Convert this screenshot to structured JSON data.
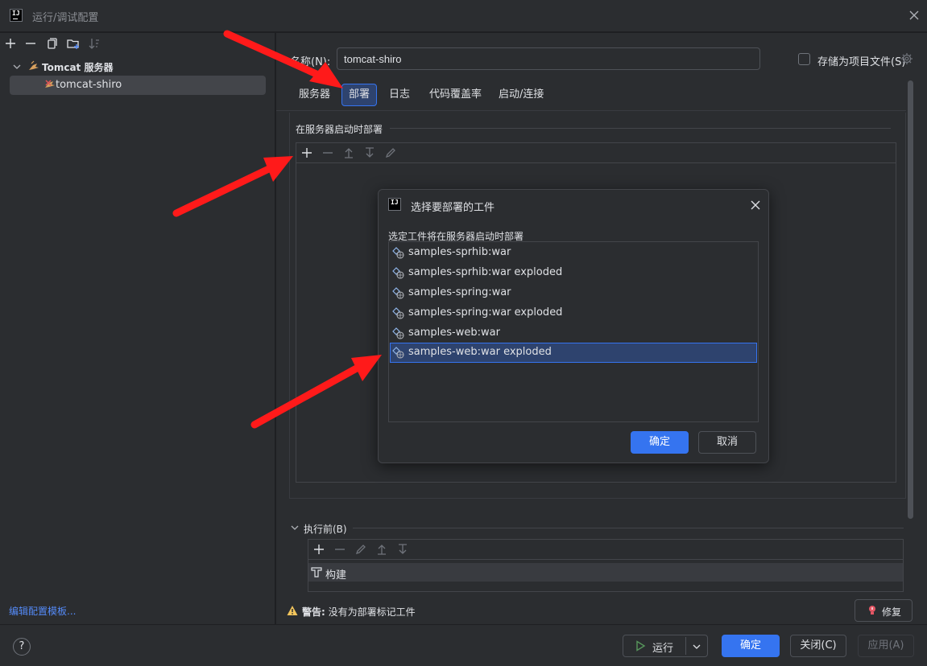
{
  "window": {
    "title": "运行/调试配置",
    "logo_text": "IJ"
  },
  "left_panel": {
    "tree": {
      "group_label": "Tomcat 服务器",
      "item_label": "tomcat-shiro"
    },
    "edit_templates_link": "编辑配置模板..."
  },
  "config": {
    "name_label": "名称(N):",
    "name_value": "tomcat-shiro",
    "store_as_project_file_label": "存储为项目文件(S)",
    "store_as_project_file_checked": false,
    "tabs": [
      {
        "label": "服务器",
        "selected": false
      },
      {
        "label": "部署",
        "selected": true
      },
      {
        "label": "日志",
        "selected": false
      },
      {
        "label": "代码覆盖率",
        "selected": false
      },
      {
        "label": "启动/连接",
        "selected": false
      }
    ],
    "deploy_section_title": "在服务器启动时部署",
    "before_launch_title": "执行前(B)",
    "before_launch_items": [
      "构建"
    ],
    "warning_prefix": "警告:",
    "warning_text": "没有为部署标记工件",
    "fix_button": "修复"
  },
  "dialog": {
    "title": "选择要部署的工件",
    "description": "选定工件将在服务器启动时部署",
    "artifacts": [
      "samples-sprhib:war",
      "samples-sprhib:war exploded",
      "samples-spring:war",
      "samples-spring:war exploded",
      "samples-web:war",
      "samples-web:war exploded"
    ],
    "selected_artifact": "samples-web:war exploded",
    "ok_button": "确定",
    "cancel_button": "取消"
  },
  "bottom": {
    "help": "?",
    "run_button": "运行",
    "ok_button": "确定",
    "close_button": "关闭(C)",
    "apply_button": "应用(A)"
  },
  "colors": {
    "background": "#2b2d30",
    "accent": "#3574f0",
    "selection": "#2e436e",
    "link": "#548af7",
    "warning": "#f2c55c",
    "annotation_arrow": "#ff1a1a"
  }
}
